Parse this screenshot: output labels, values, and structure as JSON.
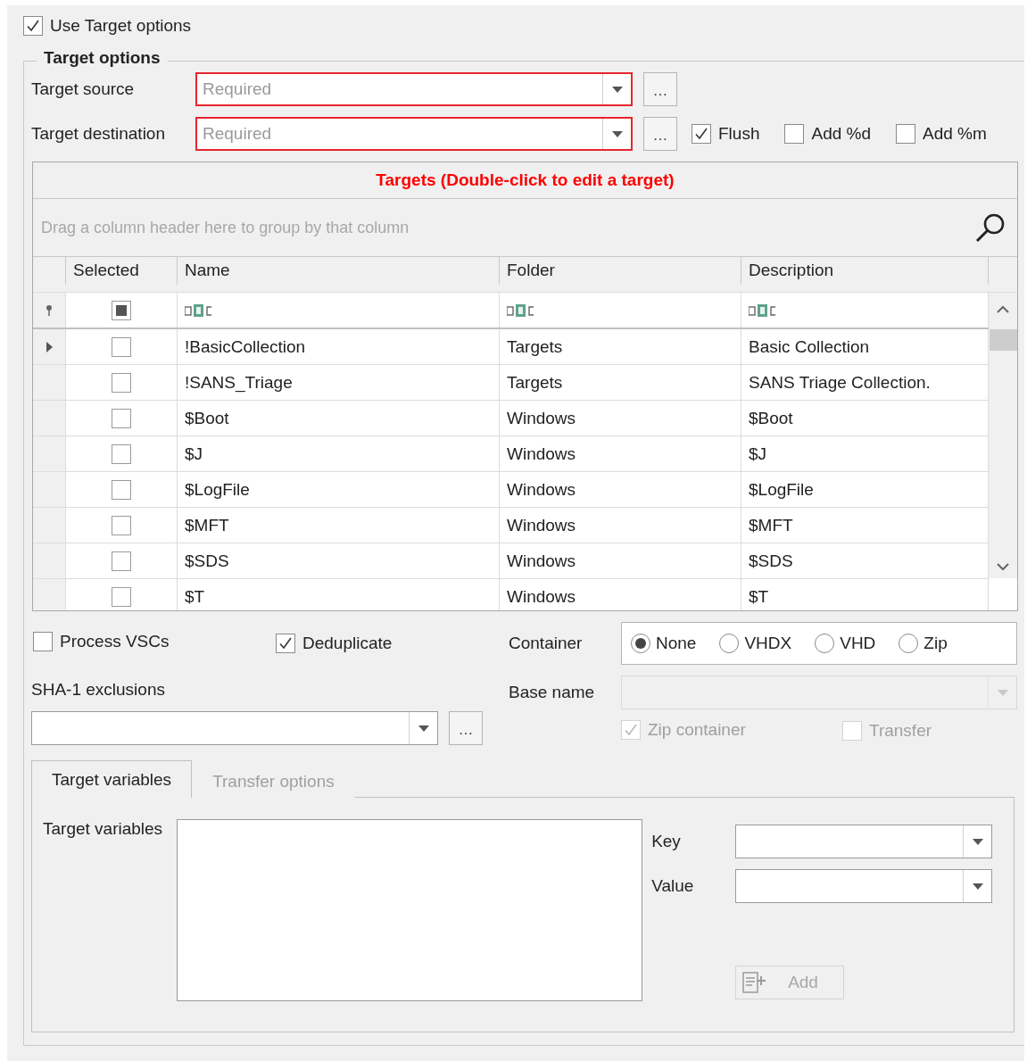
{
  "use_target_options": {
    "label": "Use Target options",
    "checked": true
  },
  "group_title": "Target options",
  "target_source": {
    "label": "Target source",
    "placeholder": "Required",
    "invalid": true,
    "browse": "…"
  },
  "target_destination": {
    "label": "Target destination",
    "placeholder": "Required",
    "invalid": true,
    "browse": "…"
  },
  "flags": [
    {
      "label": "Flush",
      "checked": true
    },
    {
      "label": "Add %d",
      "checked": false
    },
    {
      "label": "Add %m",
      "checked": false
    }
  ],
  "grid": {
    "title": "Targets (Double-click to edit a target)",
    "group_hint": "Drag a column header here to group by that column",
    "columns": [
      "Selected",
      "Name",
      "Folder",
      "Description"
    ],
    "filter_selected_indeterminate": true,
    "rows": [
      {
        "focused": true,
        "checked": false,
        "name": "!BasicCollection",
        "folder": "Targets",
        "description": "Basic Collection"
      },
      {
        "focused": false,
        "checked": false,
        "name": "!SANS_Triage",
        "folder": "Targets",
        "description": "SANS Triage Collection."
      },
      {
        "focused": false,
        "checked": false,
        "name": "$Boot",
        "folder": "Windows",
        "description": "$Boot"
      },
      {
        "focused": false,
        "checked": false,
        "name": "$J",
        "folder": "Windows",
        "description": "$J"
      },
      {
        "focused": false,
        "checked": false,
        "name": "$LogFile",
        "folder": "Windows",
        "description": "$LogFile"
      },
      {
        "focused": false,
        "checked": false,
        "name": "$MFT",
        "folder": "Windows",
        "description": "$MFT"
      },
      {
        "focused": false,
        "checked": false,
        "name": "$SDS",
        "folder": "Windows",
        "description": "$SDS"
      },
      {
        "focused": false,
        "checked": false,
        "name": "$T",
        "folder": "Windows",
        "description": "$T"
      }
    ]
  },
  "process_vscs": {
    "label": "Process VSCs",
    "checked": false
  },
  "deduplicate": {
    "label": "Deduplicate",
    "checked": true
  },
  "container": {
    "label": "Container",
    "options": [
      {
        "label": "None",
        "selected": true
      },
      {
        "label": "VHDX",
        "selected": false
      },
      {
        "label": "VHD",
        "selected": false
      },
      {
        "label": "Zip",
        "selected": false
      }
    ]
  },
  "sha1_exclusions": {
    "label": "SHA-1 exclusions",
    "browse": "…"
  },
  "base_name": {
    "label": "Base name",
    "disabled": true
  },
  "zip_container": {
    "label": "Zip container",
    "checked": true,
    "disabled": true
  },
  "transfer": {
    "label": "Transfer",
    "checked": false,
    "disabled": true
  },
  "tabs": [
    {
      "label": "Target variables",
      "selected": true
    },
    {
      "label": "Transfer options",
      "selected": false
    }
  ],
  "target_variables": {
    "label": "Target variables"
  },
  "key": {
    "label": "Key"
  },
  "value": {
    "label": "Value"
  },
  "add_button": {
    "label": "Add",
    "disabled": true
  }
}
